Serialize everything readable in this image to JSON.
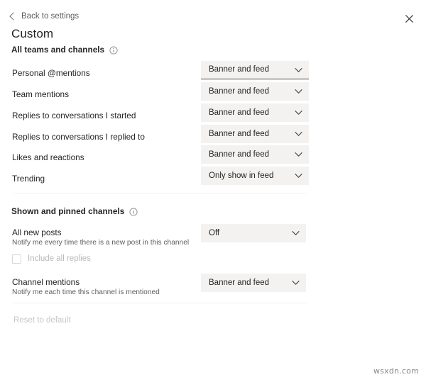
{
  "header": {
    "back_label": "Back to settings",
    "back_icon": "chevron-left-icon",
    "close_icon": "close-icon",
    "page_title": "Custom"
  },
  "colors": {
    "background": "#ffffff",
    "text_primary": "#252423",
    "text_secondary": "#605e5c",
    "text_disabled": "#c8c6c4",
    "dropdown_bg": "#f3f2f1",
    "divider": "#f0efee",
    "focus_underline": "#484644"
  },
  "sections": [
    {
      "id": "all-teams-and-channels",
      "title": "All teams and channels",
      "info_icon": "info-icon",
      "rows": [
        {
          "label": "Personal @mentions",
          "sub": "",
          "value": "Banner and feed",
          "focused": true
        },
        {
          "label": "Team mentions",
          "sub": "",
          "value": "Banner and feed",
          "focused": false
        },
        {
          "label": "Replies to conversations I started",
          "sub": "",
          "value": "Banner and feed",
          "focused": false
        },
        {
          "label": "Replies to conversations I replied to",
          "sub": "",
          "value": "Banner and feed",
          "focused": false
        },
        {
          "label": "Likes and reactions",
          "sub": "",
          "value": "Banner and feed",
          "focused": false
        },
        {
          "label": "Trending",
          "sub": "",
          "value": "Only show in feed",
          "focused": false
        }
      ]
    },
    {
      "id": "shown-and-pinned-channels",
      "title": "Shown and pinned channels",
      "info_icon": "info-icon",
      "rows": [
        {
          "label": "All new posts",
          "sub": "Notify me every time there is a new post in this channel",
          "value": "Off",
          "focused": false
        },
        {
          "label": "Channel mentions",
          "sub": "Notify me each time this channel is mentioned",
          "value": "Banner and feed",
          "focused": false
        }
      ]
    }
  ],
  "checkbox": {
    "label": "Include all replies",
    "checked": false,
    "disabled": true
  },
  "footer": {
    "reset_label": "Reset to default",
    "disabled": true
  },
  "watermark": {
    "text": "wsxdn.com"
  }
}
